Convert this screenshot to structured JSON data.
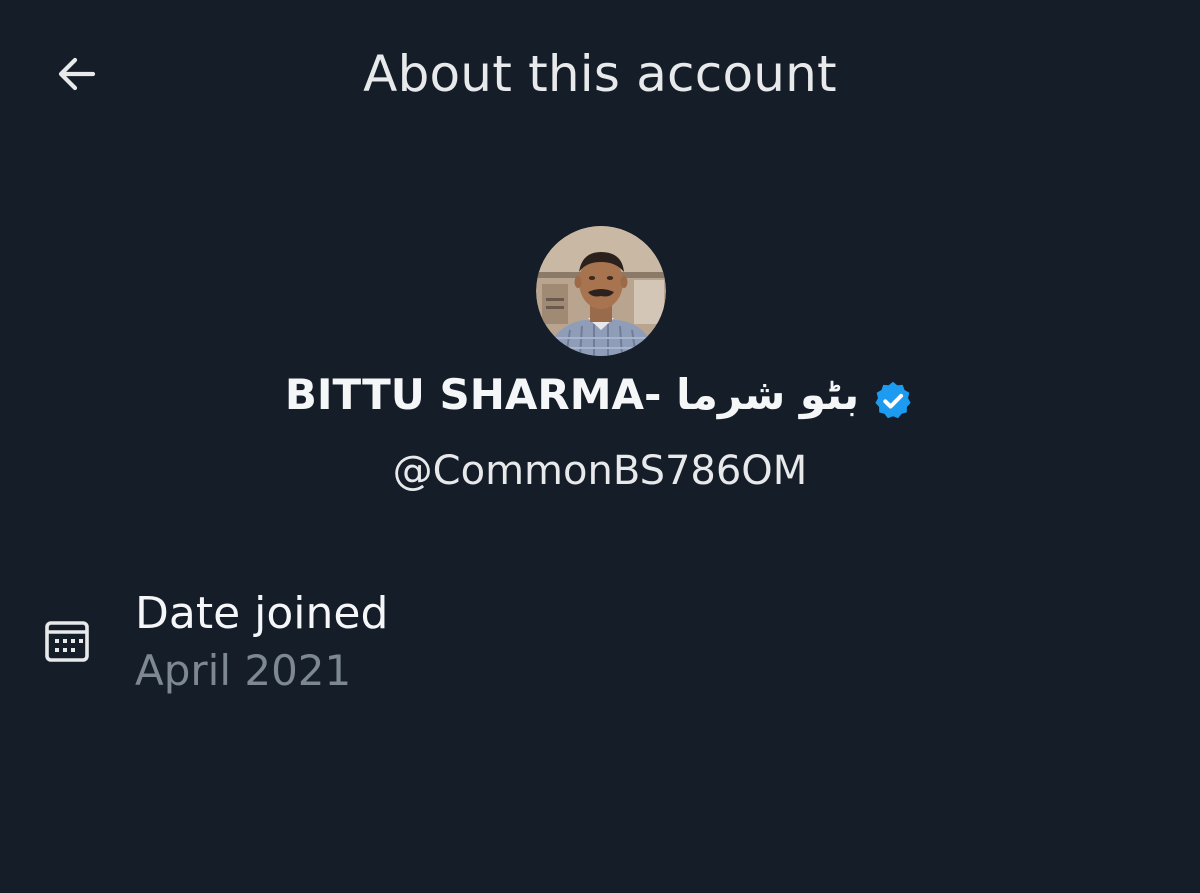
{
  "header": {
    "title": "About this account",
    "back_icon": "arrow-left-icon"
  },
  "profile": {
    "display_name": "BITTU SHARMA- بٹو شرما",
    "handle": "@CommonBS786OM",
    "verified_icon": "verified-badge-icon",
    "verified_color": "#1d9bf0"
  },
  "details": {
    "date_joined_label": "Date joined",
    "date_joined_value": "April 2021",
    "date_icon": "calendar-icon"
  },
  "colors": {
    "background": "#151d28",
    "primary_text": "#e7e9ea",
    "secondary_text": "#7d8893"
  }
}
